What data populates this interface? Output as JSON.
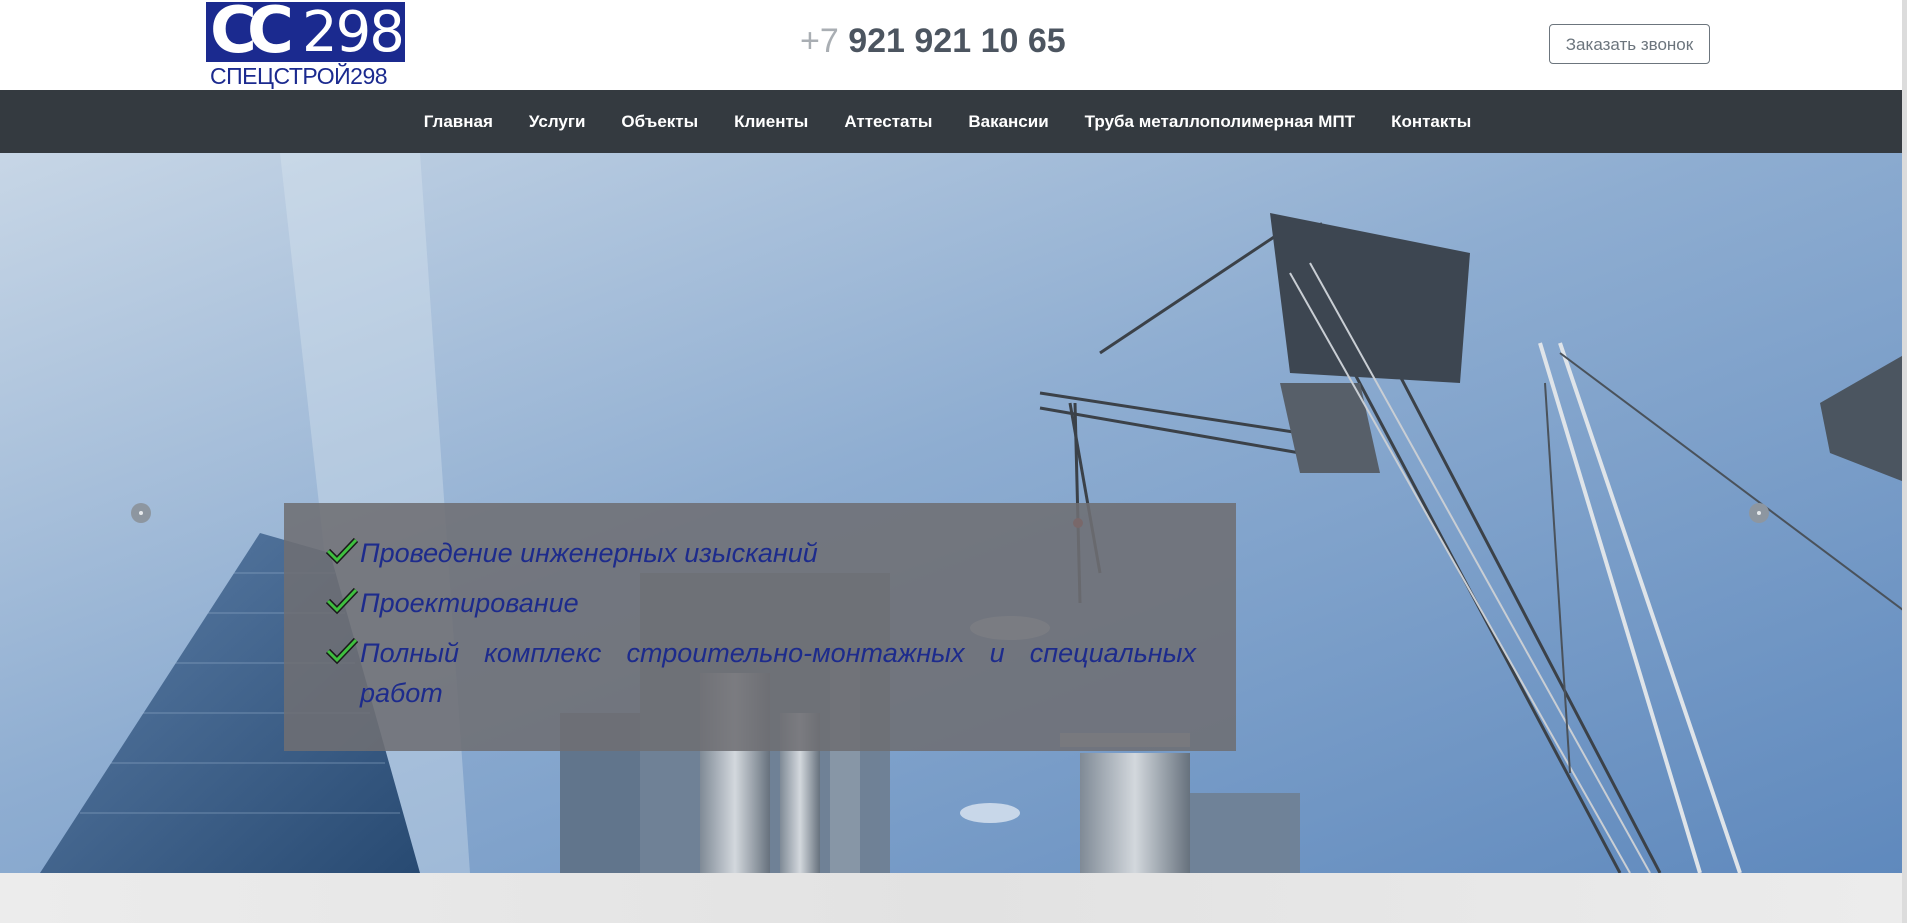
{
  "logo": {
    "mark_letters": "CC",
    "mark_number": "298",
    "wordmark": "СПЕЦСТРОЙ298"
  },
  "header": {
    "phone_prefix": "+7",
    "phone_number": "921 921 10 65",
    "callback_label": "Заказать звонок"
  },
  "nav": {
    "items": [
      {
        "label": "Главная"
      },
      {
        "label": "Услуги"
      },
      {
        "label": "Объекты"
      },
      {
        "label": "Клиенты"
      },
      {
        "label": "Аттестаты"
      },
      {
        "label": "Вакансии"
      },
      {
        "label": "Труба металлополимерная МПТ"
      },
      {
        "label": "Контакты"
      }
    ]
  },
  "hero": {
    "caption_items": [
      {
        "text": "Проведение инженерных изысканий"
      },
      {
        "text": "Проектирование"
      },
      {
        "text": "Полный комплекс строительно-монтажных и специальных работ"
      }
    ]
  },
  "colors": {
    "brand": "#1b2a8f",
    "nav_bg": "#343a40",
    "phone_text": "#4c5560",
    "check": "#3fbf3f"
  },
  "icons": {
    "check": "check-icon",
    "slider_prev": "slider-prev-dot",
    "slider_next": "slider-next-dot"
  }
}
